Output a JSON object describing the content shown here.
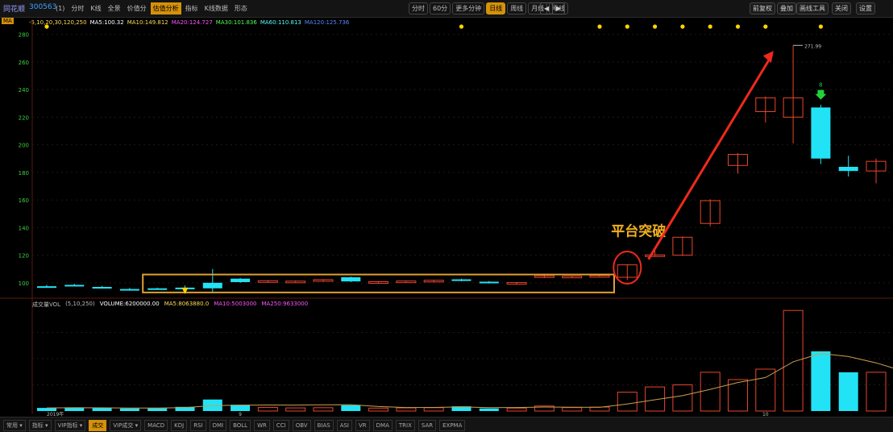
{
  "header": {
    "title": "同花顺",
    "code": "300563",
    "tabs": [
      {
        "label": "(1)"
      },
      {
        "label": "分时"
      },
      {
        "label": "K线"
      },
      {
        "label": "全景"
      },
      {
        "label": "价值分"
      },
      {
        "label": "估值分析",
        "active": true
      },
      {
        "label": "指标"
      },
      {
        "label": "K线数据"
      },
      {
        "label": "形态"
      }
    ],
    "periods": [
      {
        "label": "分时"
      },
      {
        "label": "60分"
      },
      {
        "label": "更多分钟"
      },
      {
        "label": "日线",
        "active": true
      },
      {
        "label": "周线"
      },
      {
        "label": "月线"
      },
      {
        "label": "季线"
      }
    ],
    "prev": "◀",
    "next": "▶",
    "right_controls": [
      "前复权",
      "叠加",
      "画线工具",
      "关闭",
      "设置"
    ]
  },
  "ma_legend": {
    "badge": "MA",
    "items": [
      {
        "text": "-5,10,20,30,120,250",
        "color": "#ffdd55"
      },
      {
        "text": "MA5:100.32",
        "color": "#ffffff"
      },
      {
        "text": "MA10:149.812",
        "color": "#ffdd55"
      },
      {
        "text": "MA20:124.727",
        "color": "#ff55ff"
      },
      {
        "text": "MA30:101.836",
        "color": "#55ff55"
      },
      {
        "text": "MA60:110.813",
        "color": "#55ffff"
      },
      {
        "text": "MA120:125.736",
        "color": "#5588ff"
      }
    ]
  },
  "volume_legend": {
    "items": [
      {
        "text": "成交量VOL",
        "color": "#bbbbbb"
      },
      {
        "text": "(5,10,250)",
        "color": "#bbbbbb"
      },
      {
        "text": "VOLUME:6200000.00",
        "color": "#ffffff"
      },
      {
        "text": "MA5:8063880.0",
        "color": "#ffdd55"
      },
      {
        "text": "MA10:5003000",
        "color": "#ff55ff"
      },
      {
        "text": "MA250:9633000",
        "color": "#ff55ff"
      }
    ]
  },
  "bottom_bar": {
    "items": [
      {
        "label": "常用 ▾"
      },
      {
        "label": "指标 ▾"
      },
      {
        "label": "VIP指标 ▾"
      },
      {
        "label": "成交",
        "active": true
      },
      {
        "label": "VIP成交 ▾"
      },
      {
        "label": "MACD"
      },
      {
        "label": "KDJ"
      },
      {
        "label": "RSI"
      },
      {
        "label": "DMI"
      },
      {
        "label": "BOLL"
      },
      {
        "label": "WR"
      },
      {
        "label": "CCI"
      },
      {
        "label": "OBV"
      },
      {
        "label": "BIAS"
      },
      {
        "label": "ASI"
      },
      {
        "label": "VR"
      },
      {
        "label": "DMA"
      },
      {
        "label": "TRIX"
      },
      {
        "label": "SAR"
      },
      {
        "label": "EXPMA"
      }
    ]
  },
  "annotations": {
    "breakout_label": "平台突破",
    "high_label": "271.99",
    "signal_label": "8"
  },
  "chart_data": {
    "type": "candlestick",
    "title": "",
    "price_axis": {
      "ticks": [
        100,
        120,
        140,
        160,
        180,
        200,
        220,
        240,
        260,
        280
      ],
      "ylim": [
        90,
        285
      ]
    },
    "x_ticks": [
      {
        "index": 0,
        "label": "2019年"
      },
      {
        "index": 7,
        "label": "9"
      },
      {
        "index": 26,
        "label": "10"
      }
    ],
    "candles": [
      {
        "o": 97.5,
        "h": 98.5,
        "l": 96.5,
        "c": 97.0
      },
      {
        "o": 98.5,
        "h": 99.3,
        "l": 97.8,
        "c": 98.0
      },
      {
        "o": 97.0,
        "h": 97.8,
        "l": 95.8,
        "c": 96.0
      },
      {
        "o": 95.5,
        "h": 96.3,
        "l": 94.3,
        "c": 94.8
      },
      {
        "o": 96.0,
        "h": 96.5,
        "l": 95.0,
        "c": 95.5
      },
      {
        "o": 96.5,
        "h": 98.0,
        "l": 95.5,
        "c": 96.2
      },
      {
        "o": 100.0,
        "h": 110.0,
        "l": 93.0,
        "c": 96.0
      },
      {
        "o": 103.0,
        "h": 103.5,
        "l": 100.0,
        "c": 100.5
      },
      {
        "o": 101.0,
        "h": 101.8,
        "l": 100.2,
        "c": 101.5
      },
      {
        "o": 101.0,
        "h": 101.6,
        "l": 100.4,
        "c": 101.2
      },
      {
        "o": 102.0,
        "h": 102.6,
        "l": 101.4,
        "c": 102.3
      },
      {
        "o": 104.0,
        "h": 104.5,
        "l": 100.5,
        "c": 101.0
      },
      {
        "o": 100.5,
        "h": 101.2,
        "l": 99.8,
        "c": 100.8
      },
      {
        "o": 101.0,
        "h": 101.6,
        "l": 100.5,
        "c": 101.3
      },
      {
        "o": 101.5,
        "h": 102.0,
        "l": 100.8,
        "c": 101.8
      },
      {
        "o": 102.5,
        "h": 103.0,
        "l": 101.0,
        "c": 101.5
      },
      {
        "o": 100.8,
        "h": 101.3,
        "l": 99.5,
        "c": 99.9
      },
      {
        "o": 99.5,
        "h": 100.5,
        "l": 99.0,
        "c": 100.2
      },
      {
        "o": 104.0,
        "h": 105.5,
        "l": 103.5,
        "c": 105.0
      },
      {
        "o": 104.5,
        "h": 105.0,
        "l": 104.0,
        "c": 104.8
      },
      {
        "o": 105.0,
        "h": 105.5,
        "l": 104.5,
        "c": 105.2
      },
      {
        "o": 104.0,
        "h": 113.5,
        "l": 102.0,
        "c": 113.0
      },
      {
        "o": 120.0,
        "h": 124.0,
        "l": 119.5,
        "c": 120.2
      },
      {
        "o": 120.0,
        "h": 133.5,
        "l": 119.5,
        "c": 133.0
      },
      {
        "o": 143.0,
        "h": 160.5,
        "l": 141.0,
        "c": 159.5
      },
      {
        "o": 185.0,
        "h": 194.0,
        "l": 179.0,
        "c": 193.0
      },
      {
        "o": 224.0,
        "h": 235.0,
        "l": 216.0,
        "c": 234.0
      },
      {
        "o": 220.0,
        "h": 272.0,
        "l": 201.0,
        "c": 234.0
      },
      {
        "o": 227.0,
        "h": 229.0,
        "l": 186.0,
        "c": 190.0
      },
      {
        "o": 184.0,
        "h": 192.0,
        "l": 177.0,
        "c": 181.0
      },
      {
        "o": 181.0,
        "h": 190.0,
        "l": 172.0,
        "c": 188.0
      },
      {
        "o": 184.0,
        "h": 189.0,
        "l": 180.0,
        "c": 181.0
      }
    ],
    "volume": {
      "values": [
        30,
        35,
        28,
        25,
        26,
        40,
        110,
        60,
        35,
        30,
        32,
        55,
        28,
        30,
        32,
        45,
        25,
        28,
        48,
        33,
        38,
        180,
        230,
        250,
        370,
        300,
        400,
        960,
        570,
        370,
        370,
        280
      ],
      "ma_line": [
        30,
        32,
        31,
        29,
        29,
        33,
        52,
        56,
        58,
        57,
        60,
        61,
        43,
        34,
        35,
        39,
        33,
        34,
        38,
        37,
        36,
        67,
        108,
        147,
        207,
        272,
        320,
        470,
        550,
        520,
        460,
        380
      ],
      "ylim": [
        0,
        1000
      ]
    },
    "series": []
  },
  "colors": {
    "up": "#e8452c",
    "down": "#22e3f5",
    "accent": "#d4910a",
    "grid": "#2a1410",
    "ma": "#c8a050",
    "arrow": "#ee2a1c",
    "marker": "#ffd400",
    "signal": "#22d13a"
  }
}
